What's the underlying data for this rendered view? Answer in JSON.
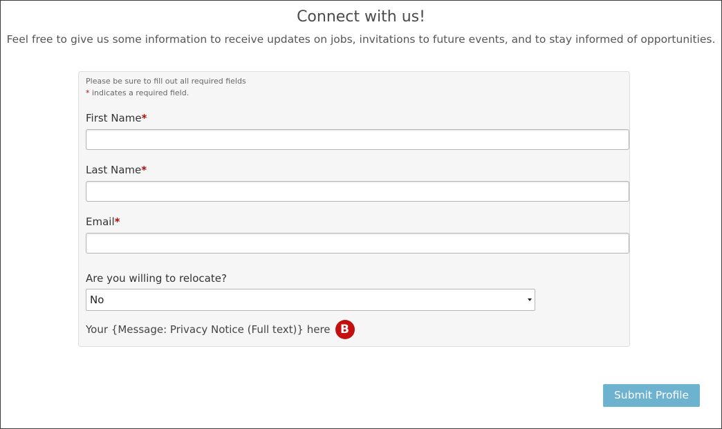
{
  "page": {
    "title": "Connect with us!",
    "intro": "Feel free to give us some information to receive updates on jobs, invitations to future events, and to stay informed of opportunities."
  },
  "form": {
    "note_required": "Please be sure to fill out all required fields",
    "note_asterisk": "*",
    "note_indicates": " indicates a required field.",
    "required_marker": "*",
    "fields": {
      "first_name": {
        "label": "First Name",
        "value": "",
        "placeholder": ""
      },
      "last_name": {
        "label": "Last Name",
        "value": "",
        "placeholder": ""
      },
      "email": {
        "label": "Email",
        "value": "",
        "placeholder": ""
      }
    },
    "relocate": {
      "label": "Are you willing to relocate?",
      "selected": "No"
    },
    "privacy": {
      "text": "Your {Message: Privacy Notice (Full text)} here",
      "badge": "B"
    },
    "submit_label": "Submit Profile"
  },
  "colors": {
    "required": "#b10e0e",
    "submit_button": "#6db3d0",
    "badge": "#c3100f",
    "card_background": "#f6f6f6"
  },
  "icons": {
    "select_caret": "caret-down-icon",
    "badge": "b-badge-icon"
  }
}
